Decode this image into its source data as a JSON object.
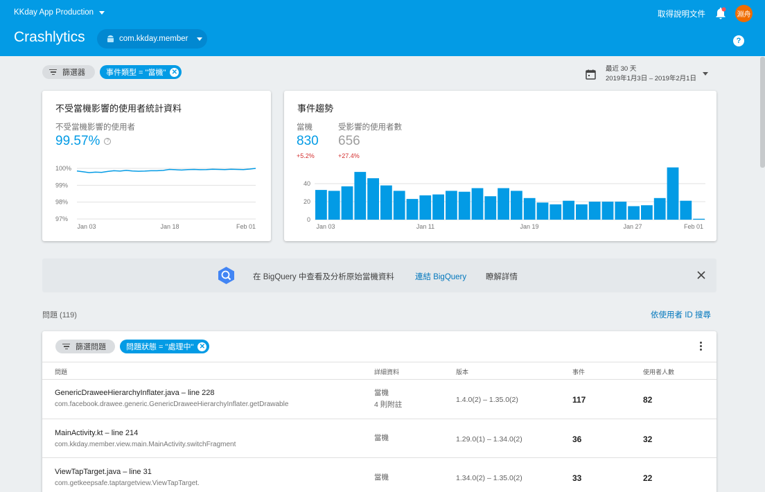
{
  "header": {
    "project": "KKday App Production",
    "docs_link": "取得說明文件",
    "avatar_text": "淵舟",
    "title": "Crashlytics",
    "app_selector": "com.kkday.member"
  },
  "filters": {
    "filter_button": "篩選器",
    "event_chip": "事件類型 = \"當機\""
  },
  "date_range": {
    "label": "最近 30 天",
    "range": "2019年1月3日 – 2019年2月1日"
  },
  "crash_free_card": {
    "title": "不受當機影響的使用者統計資料",
    "stat_label": "不受當機影響的使用者",
    "stat_value": "99.57%"
  },
  "trends_card": {
    "title": "事件趨勢",
    "crashes_label": "當機",
    "crashes_value": "830",
    "crashes_delta": "+5.2%",
    "users_label": "受影響的使用者數",
    "users_value": "656",
    "users_delta": "+27.4%"
  },
  "chart_data": [
    {
      "type": "line",
      "title": "",
      "x_ticks": [
        "Jan 03",
        "Jan 18",
        "Feb 01"
      ],
      "y_ticks": [
        "100%",
        "99%",
        "98%",
        "97%"
      ],
      "ylim": [
        97,
        100
      ],
      "series": [
        {
          "values": [
            99.85,
            99.8,
            99.75,
            99.78,
            99.76,
            99.82,
            99.86,
            99.84,
            99.88,
            99.85,
            99.83,
            99.84,
            99.86,
            99.86,
            99.88,
            99.94,
            99.92,
            99.9,
            99.93,
            99.94,
            99.92,
            99.93,
            99.95,
            99.94,
            99.93,
            99.95,
            99.94,
            99.93,
            99.96,
            100.0
          ]
        }
      ],
      "color": "#039be5",
      "grid": true
    },
    {
      "type": "bar",
      "title": "",
      "x_ticks": [
        "Jan 03",
        "Jan 11",
        "Jan 19",
        "Jan 27",
        "Feb 01"
      ],
      "y_ticks": [
        "40",
        "20",
        "0"
      ],
      "ylim": [
        0,
        60
      ],
      "values": [
        33,
        32,
        37,
        53,
        46,
        38,
        32,
        23,
        27,
        28,
        32,
        31,
        35,
        26,
        35,
        32,
        24,
        19,
        17,
        21,
        17,
        20,
        20,
        20,
        15,
        16,
        24,
        58,
        21,
        1
      ],
      "color": "#039be5",
      "grid": true
    }
  ],
  "bigquery": {
    "text": "在 BigQuery 中查看及分析原始當機資料",
    "link": "連結 BigQuery",
    "more": "瞭解詳情"
  },
  "issues": {
    "count": "問題 (119)",
    "search_by_uid": "依使用者 ID 搜尋",
    "filter_button": "篩選問題",
    "status_chip": "問題狀態 = \"處理中\"",
    "columns": {
      "issue": "問題",
      "details": "詳細資料",
      "version": "版本",
      "events": "事件",
      "users": "使用者人數"
    },
    "rows": [
      {
        "file": "GenericDraweeHierarchyInflater.java",
        "line": " – line 228",
        "method": "com.facebook.drawee.generic.GenericDraweeHierarchyInflater.getDrawable",
        "detail1": "當機",
        "detail2": "4 則附註",
        "version": "1.4.0(2) – 1.35.0(2)",
        "events": "117",
        "users": "82"
      },
      {
        "file": "MainActivity.kt",
        "line": " – line 214",
        "method": "com.kkday.member.view.main.MainActivity.switchFragment",
        "detail1": "當機",
        "detail2": "",
        "version": "1.29.0(1) – 1.34.0(2)",
        "events": "36",
        "users": "32"
      },
      {
        "file": "ViewTapTarget.java",
        "line": " – line 31",
        "method": "com.getkeepsafe.taptargetview.ViewTapTarget.",
        "detail1": "當機",
        "detail2": "",
        "version": "1.34.0(2) – 1.35.0(2)",
        "events": "33",
        "users": "22"
      }
    ]
  }
}
